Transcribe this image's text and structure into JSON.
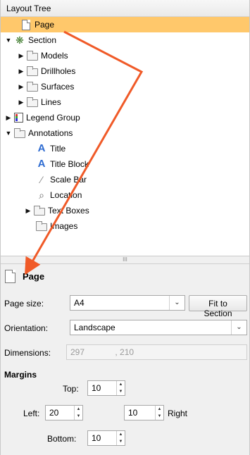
{
  "tree": {
    "header": "Layout Tree",
    "items": [
      {
        "label": "Page"
      },
      {
        "label": "Section"
      },
      {
        "label": "Models"
      },
      {
        "label": "Drillholes"
      },
      {
        "label": "Surfaces"
      },
      {
        "label": "Lines"
      },
      {
        "label": "Legend Group"
      },
      {
        "label": "Annotations"
      },
      {
        "label": "Title"
      },
      {
        "label": "Title Block"
      },
      {
        "label": "Scale Bar"
      },
      {
        "label": "Location"
      },
      {
        "label": "Text Boxes"
      },
      {
        "label": "Images"
      }
    ]
  },
  "splitter_glyph": "III",
  "props": {
    "title": "Page",
    "page_size_label": "Page size:",
    "page_size_value": "A4",
    "fit_button": "Fit to Section",
    "orientation_label": "Orientation:",
    "orientation_value": "Landscape",
    "dimensions_label": "Dimensions:",
    "dim_w": "297",
    "dim_sep": ", 210",
    "margins_label": "Margins",
    "top_label": "Top:",
    "top_value": "10",
    "left_label": "Left:",
    "left_value": "20",
    "right_value": "10",
    "right_label": "Right",
    "bottom_label": "Bottom:",
    "bottom_value": "10"
  },
  "colors": {
    "selection": "#ffc86b",
    "annotation_arrow": "#f05a28"
  }
}
